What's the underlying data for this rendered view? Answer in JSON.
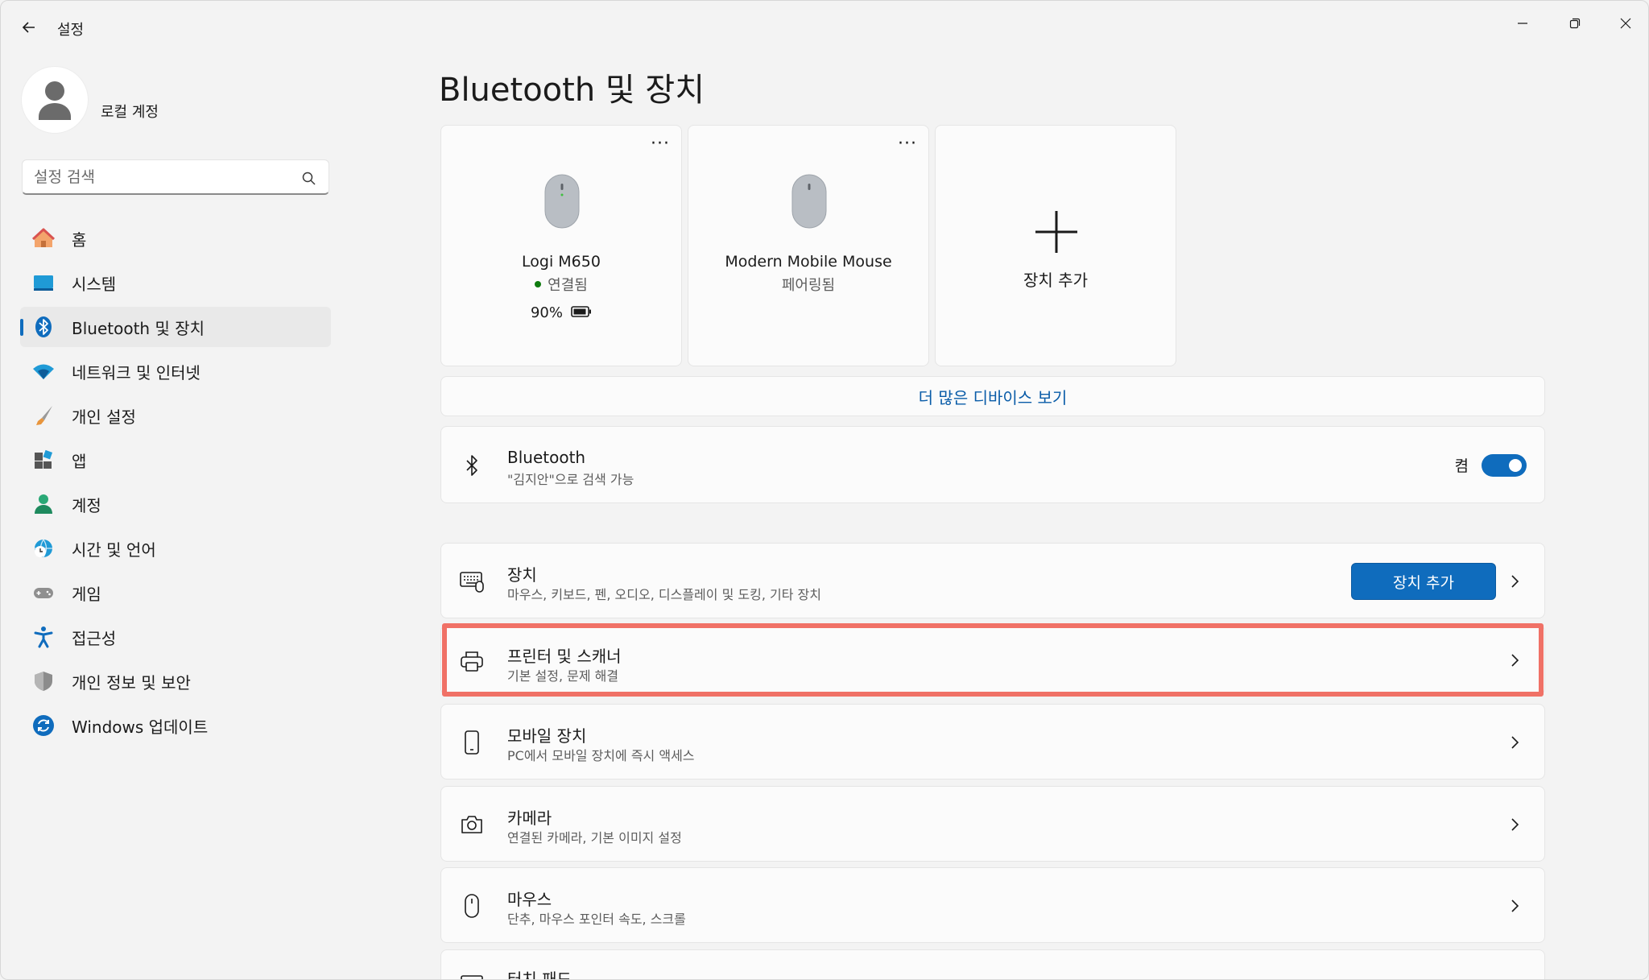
{
  "window": {
    "title": "설정",
    "controls": [
      "minimize",
      "restore",
      "close"
    ]
  },
  "profile": {
    "name": "로컬 계정"
  },
  "search": {
    "placeholder": "설정 검색"
  },
  "sidebar": {
    "items": [
      {
        "label": "홈",
        "icon": "home-icon",
        "active": false
      },
      {
        "label": "시스템",
        "icon": "system-icon",
        "active": false
      },
      {
        "label": "Bluetooth 및 장치",
        "icon": "bluetooth-icon",
        "active": true
      },
      {
        "label": "네트워크 및 인터넷",
        "icon": "wifi-icon",
        "active": false
      },
      {
        "label": "개인 설정",
        "icon": "brush-icon",
        "active": false
      },
      {
        "label": "앱",
        "icon": "apps-icon",
        "active": false
      },
      {
        "label": "계정",
        "icon": "account-icon",
        "active": false
      },
      {
        "label": "시간 및 언어",
        "icon": "time-language-icon",
        "active": false
      },
      {
        "label": "게임",
        "icon": "gaming-icon",
        "active": false
      },
      {
        "label": "접근성",
        "icon": "accessibility-icon",
        "active": false
      },
      {
        "label": "개인 정보 및 보안",
        "icon": "shield-icon",
        "active": false
      },
      {
        "label": "Windows 업데이트",
        "icon": "update-icon",
        "active": false
      }
    ]
  },
  "main": {
    "title": "Bluetooth 및 장치",
    "device_cards": [
      {
        "name": "Logi M650",
        "status": "연결됨",
        "connected": true,
        "battery": "90%"
      },
      {
        "name": "Modern Mobile Mouse",
        "status": "페어링됨",
        "connected": false
      }
    ],
    "add_device_card": {
      "label": "장치 추가"
    },
    "more_devices_link": "더 많은 디바이스 보기",
    "bluetooth_row": {
      "title": "Bluetooth",
      "subtitle": "\"김지안\"으로 검색 가능",
      "toggle_label": "켬",
      "toggle_on": true
    },
    "rows": [
      {
        "title": "장치",
        "subtitle": "마우스, 키보드, 펜, 오디오, 디스플레이 및 도킹, 기타 장치",
        "button": "장치 추가",
        "icon": "devices-icon"
      },
      {
        "title": "프린터 및 스캐너",
        "subtitle": "기본 설정, 문제 해결",
        "icon": "printer-icon",
        "highlighted": true
      },
      {
        "title": "모바일 장치",
        "subtitle": "PC에서 모바일 장치에 즉시 액세스",
        "icon": "phone-icon"
      },
      {
        "title": "카메라",
        "subtitle": "연결된 카메라, 기본 이미지 설정",
        "icon": "camera-icon"
      },
      {
        "title": "마우스",
        "subtitle": "단추, 마우스 포인터 속도, 스크롤",
        "icon": "mouse-icon"
      },
      {
        "title": "터치 패드",
        "subtitle": "",
        "icon": "touchpad-icon"
      }
    ]
  },
  "colors": {
    "accent": "#0f6cbd",
    "highlight": "#f07166",
    "connected_dot": "#0f7b0f",
    "link": "#0a5ca8"
  }
}
